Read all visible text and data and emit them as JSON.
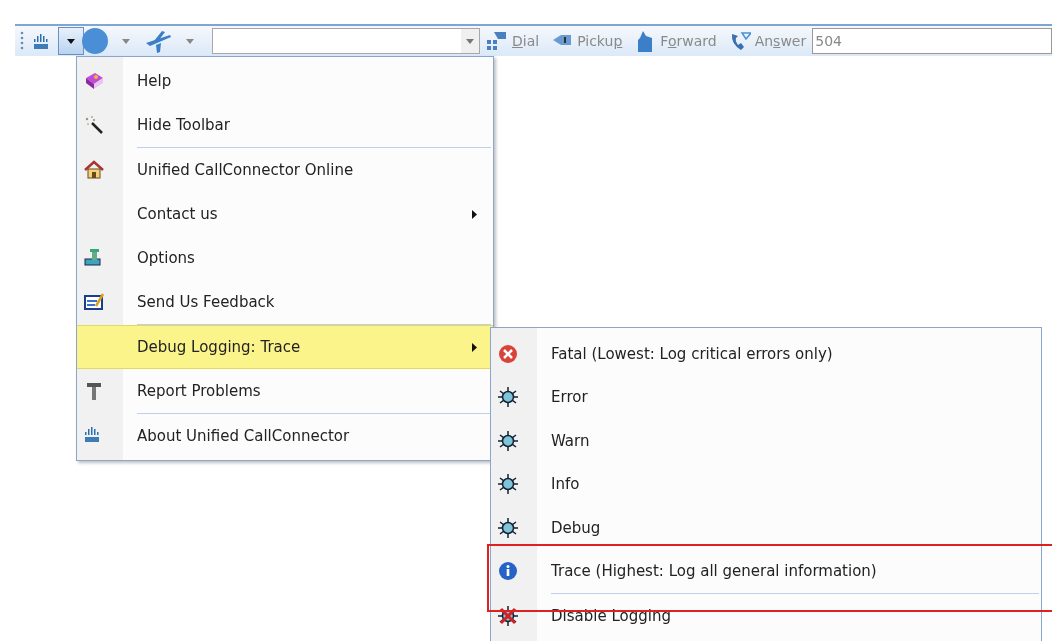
{
  "toolbar": {
    "menu_open": true,
    "actions": [
      {
        "kind": "dial",
        "key": "D",
        "post": "ial"
      },
      {
        "kind": "pickup",
        "pre": "Picku",
        "key": "p"
      },
      {
        "kind": "forward",
        "pre": "F",
        "key": "o",
        "post": "rward"
      },
      {
        "kind": "answer",
        "pre": "An",
        "key": "s",
        "post": "wer"
      }
    ],
    "number_field": "504"
  },
  "menu": {
    "items": [
      {
        "kind": "help",
        "label": "Help",
        "submenu": false,
        "selected": false,
        "separator_after": false
      },
      {
        "kind": "wand",
        "label": "Hide Toolbar",
        "submenu": false,
        "selected": false,
        "separator_after": true
      },
      {
        "kind": "home",
        "label": "Unified CallConnector Online",
        "submenu": false,
        "selected": false,
        "separator_after": false
      },
      {
        "kind": "none",
        "label": "Contact us",
        "submenu": true,
        "selected": false,
        "separator_after": false
      },
      {
        "kind": "options",
        "label": "Options",
        "submenu": false,
        "selected": false,
        "separator_after": false
      },
      {
        "kind": "feedback",
        "label": "Send Us Feedback",
        "submenu": false,
        "selected": false,
        "separator_after": true
      },
      {
        "kind": "none",
        "label": "Debug Logging: Trace",
        "submenu": true,
        "selected": true,
        "separator_after": false
      },
      {
        "kind": "hammer",
        "label": "Report Problems",
        "submenu": false,
        "selected": false,
        "separator_after": true
      },
      {
        "kind": "logo",
        "label": "About Unified CallConnector",
        "submenu": false,
        "selected": false,
        "separator_after": false
      }
    ]
  },
  "submenu": {
    "items": [
      {
        "kind": "fatal",
        "label": "Fatal (Lowest: Log critical errors only)",
        "annotated": false,
        "separator_after": false
      },
      {
        "kind": "bug",
        "label": "Error",
        "annotated": false,
        "separator_after": false
      },
      {
        "kind": "bug",
        "label": "Warn",
        "annotated": false,
        "separator_after": false
      },
      {
        "kind": "bug",
        "label": "Info",
        "annotated": false,
        "separator_after": false
      },
      {
        "kind": "bug",
        "label": "Debug",
        "annotated": false,
        "separator_after": false
      },
      {
        "kind": "info",
        "label": "Trace (Highest: Log all general information)",
        "annotated": true,
        "separator_after": true
      },
      {
        "kind": "disable",
        "label": "Disable Logging",
        "annotated": false,
        "separator_after": false
      }
    ]
  }
}
